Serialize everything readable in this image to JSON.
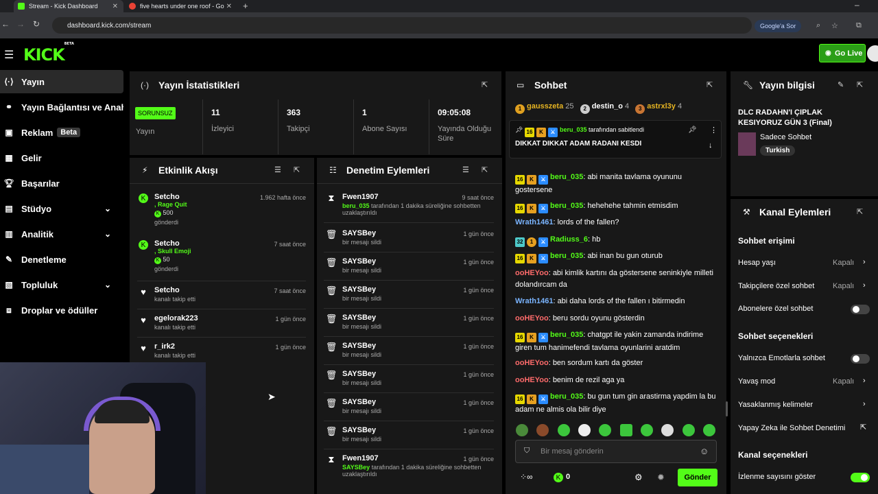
{
  "browser": {
    "tabs": [
      {
        "label": "Stream - Kick Dashboard"
      },
      {
        "label": "five hearts under one roof - Go"
      }
    ],
    "url": "dashboard.kick.com/stream",
    "ask_google": "Google'a Sor"
  },
  "header": {
    "logo": "KICK",
    "beta": "BETA",
    "go_live": "Go Live"
  },
  "sidebar": {
    "items": [
      {
        "label": "Yayın"
      },
      {
        "label": "Yayın Bağlantısı ve Anahtar"
      },
      {
        "label": "Reklam",
        "badge": "Beta"
      },
      {
        "label": "Gelir"
      },
      {
        "label": "Başarılar"
      },
      {
        "label": "Stüdyo"
      },
      {
        "label": "Analitik"
      },
      {
        "label": "Denetleme"
      },
      {
        "label": "Topluluk"
      },
      {
        "label": "Droplar ve ödüller"
      }
    ]
  },
  "stats": {
    "title": "Yayın İstatistikleri",
    "status": "SORUNSUZ",
    "status_label": "Yayın",
    "items": [
      {
        "value": "11",
        "label": "İzleyici"
      },
      {
        "value": "363",
        "label": "Takipçi"
      },
      {
        "value": "1",
        "label": "Abone Sayısı"
      },
      {
        "value": "09:05:08",
        "label": "Yayında Olduğu Süre"
      }
    ]
  },
  "activity": {
    "title": "Etkinlik Akışı",
    "items": [
      {
        "name": "Setcho",
        "time": "1.962 hafta önce",
        "detail": ", Rage Quit",
        "amount": "500",
        "action": "gönderdi"
      },
      {
        "name": "Setcho",
        "time": "7 saat önce",
        "detail": ", Skull Emoji",
        "amount": "50",
        "action": "gönderdi"
      },
      {
        "name": "Setcho",
        "time": "7 saat önce",
        "action": "kanalı takip etti"
      },
      {
        "name": "egelorak223",
        "time": "1 gün önce",
        "action": "kanalı takip etti"
      },
      {
        "name": "r_irk2",
        "time": "1 gün önce",
        "action": "kanalı takip etti"
      }
    ]
  },
  "moderation": {
    "title": "Denetim Eylemleri",
    "items": [
      {
        "name": "Fwen1907",
        "time": "9 saat önce",
        "actor": "beru_035",
        "detail": "tarafından 1 dakika süreliğine sohbetten uzaklaştırıldı",
        "icon": "hourglass"
      },
      {
        "name": "SAYSBey",
        "time": "1 gün önce",
        "detail": "bir mesajı sildi",
        "icon": "trash"
      },
      {
        "name": "SAYSBey",
        "time": "1 gün önce",
        "detail": "bir mesajı sildi",
        "icon": "trash"
      },
      {
        "name": "SAYSBey",
        "time": "1 gün önce",
        "detail": "bir mesajı sildi",
        "icon": "trash"
      },
      {
        "name": "SAYSBey",
        "time": "1 gün önce",
        "detail": "bir mesajı sildi",
        "icon": "trash"
      },
      {
        "name": "SAYSBey",
        "time": "1 gün önce",
        "detail": "bir mesajı sildi",
        "icon": "trash"
      },
      {
        "name": "SAYSBey",
        "time": "1 gün önce",
        "detail": "bir mesajı sildi",
        "icon": "trash"
      },
      {
        "name": "SAYSBey",
        "time": "1 gün önce",
        "detail": "bir mesajı sildi",
        "icon": "trash"
      },
      {
        "name": "SAYSBey",
        "time": "1 gün önce",
        "detail": "bir mesajı sildi",
        "icon": "trash"
      },
      {
        "name": "Fwen1907",
        "time": "1 gün önce",
        "actor": "SAYSBey",
        "detail": "tarafından 1 dakika süreliğine sohbetten uzaklaştırıldı",
        "icon": "hourglass"
      }
    ]
  },
  "chat": {
    "title": "Sohbet",
    "leaders": [
      {
        "rank": "1",
        "name": "gausszeta",
        "count": "25"
      },
      {
        "rank": "2",
        "name": "destin_o",
        "count": "4"
      },
      {
        "rank": "3",
        "name": "astrxl3y",
        "count": "4"
      }
    ],
    "pinned": {
      "by": "beru_035",
      "by_text": "tarafından sabitlendi",
      "text": "DIKKAT DIKKAT ADAM RADANI KESDI"
    },
    "messages": [
      {
        "user": "beru_035",
        "text": "abi manita tavlama oyununu gostersene"
      },
      {
        "user": "beru_035",
        "text": "hehehehe tahmin etmisdim"
      },
      {
        "user": "Wrath1461",
        "text": "lords of the fallen?"
      },
      {
        "user": "Radiuss_6",
        "text": "hb"
      },
      {
        "user": "beru_035",
        "text": "abi inan bu gun oturub"
      },
      {
        "user": "ooHEYoo",
        "text": "abi kimlik kartını da göstersene seninkiyle milleti dolandırcam da"
      },
      {
        "user": "Wrath1461",
        "text": "abi daha lords of the fallen ı bitirmedin"
      },
      {
        "user": "ooHEYoo",
        "text": "beru sordu oyunu gösterdin"
      },
      {
        "user": "beru_035",
        "text": "chatgpt ile yakin zamanda indirime giren tum hanimefendi tavlama oyunlarini aratdim"
      },
      {
        "user": "ooHEYoo",
        "text": "ben sordum kartı da göster"
      },
      {
        "user": "ooHEYoo",
        "text": "benim de rezil aga ya"
      },
      {
        "user": "beru_035",
        "text": "bu gun tum gin arastirma yapdim la bu adam ne almis ola bilir diye"
      }
    ],
    "placeholder": "Bir mesaj gönderin",
    "send": "Gönder",
    "points": "0",
    "colors": {
      "beru_035": "#53fc18",
      "Wrath1461": "#7ab4ff",
      "Radiuss_6": "#53fc18",
      "ooHEYoo": "#ff6b6b"
    }
  },
  "info": {
    "title": "Yayın bilgisi",
    "stream_title": "DLC RADAHN'I ÇIPLAK KESIYORUZ GÜN 3 (Final)",
    "category": "Sadece Sohbet",
    "tag": "Turkish"
  },
  "actions": {
    "title": "Kanal Eylemleri",
    "h1": "Sohbet erişimi",
    "account_age": "Hesap yaşı",
    "account_age_val": "Kapalı",
    "followers_only": "Takipçilere özel sohbet",
    "followers_only_val": "Kapalı",
    "subs_only": "Abonelere özel sohbet",
    "h2": "Sohbet seçenekleri",
    "emote_only": "Yalnızca Emotlarla sohbet",
    "slow_mode": "Yavaş mod",
    "slow_mode_val": "Kapalı",
    "banned_words": "Yasaklanmış kelimeler",
    "ai_mod": "Yapay Zeka ile Sohbet Denetimi",
    "h3": "Kanal seçenekleri",
    "show_viewers": "İzlenme sayısını göster"
  }
}
